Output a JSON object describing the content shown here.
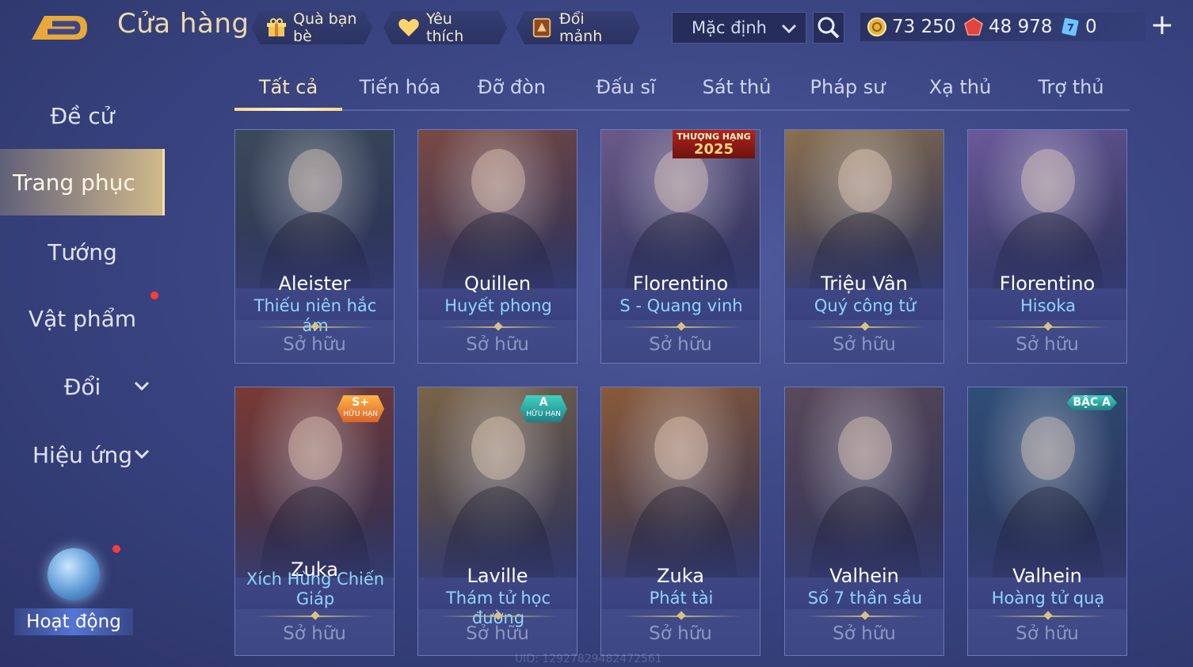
{
  "header": {
    "title": "Cửa hàng",
    "gift_label": "Quà bạn bè",
    "favorite_label": "Yêu thích",
    "shard_label": "Đổi mảnh",
    "sort_value": "Mặc định"
  },
  "currency": {
    "gold": "73 250",
    "ruby": "48 978",
    "voucher": "0"
  },
  "sidebar": {
    "items": [
      {
        "label": "Đề cử"
      },
      {
        "label": "Trang phục"
      },
      {
        "label": "Tướng"
      },
      {
        "label": "Vật phẩm"
      },
      {
        "label": "Đổi"
      },
      {
        "label": "Hiệu ứng"
      }
    ],
    "event_label": "Hoạt động"
  },
  "tabs": [
    "Tất cả",
    "Tiến hóa",
    "Đỡ đòn",
    "Đấu sĩ",
    "Sát thủ",
    "Pháp sư",
    "Xạ thủ",
    "Trợ thủ"
  ],
  "cards": [
    {
      "hero": "Aleister",
      "skin": "Thiếu niên hắc ám",
      "status": "Sở hữu",
      "art_color": "#3b4a5a"
    },
    {
      "hero": "Quillen",
      "skin": "Huyết phong",
      "status": "Sở hữu",
      "art_color": "#7a4a44"
    },
    {
      "hero": "Florentino",
      "skin": "S - Quang vinh",
      "status": "Sở hữu",
      "art_color": "#6a5a8a",
      "ribbon_top": "THƯỢNG HẠNG",
      "ribbon_year": "2025"
    },
    {
      "hero": "Triệu Vân",
      "skin": "Quý công tử",
      "status": "Sở hữu",
      "art_color": "#8a7050"
    },
    {
      "hero": "Florentino",
      "skin": "Hisoka",
      "status": "Sở hữu",
      "art_color": "#6a5a9a"
    },
    {
      "hero": "Zuka",
      "skin": "Xích Hùng Chiến Giáp",
      "status": "Sở hữu",
      "art_color": "#7a3a34",
      "badge": "S+",
      "badge_sub": "HỮU HẠN"
    },
    {
      "hero": "Laville",
      "skin": "Thám tử học đường",
      "status": "Sở hữu",
      "art_color": "#7a6448",
      "badge": "A",
      "badge_sub": "HỮU HẠN"
    },
    {
      "hero": "Zuka",
      "skin": "Phát tài",
      "status": "Sở hữu",
      "art_color": "#8a5a3a"
    },
    {
      "hero": "Valhein",
      "skin": "Số 7 thần sầu",
      "status": "Sở hữu",
      "art_color": "#5a4a5a"
    },
    {
      "hero": "Valhein",
      "skin": "Hoàng tử quạ",
      "status": "Sở hữu",
      "art_color": "#2f4f78",
      "badge": "BẬC A"
    }
  ],
  "uid": "UID: 1292782948247256​1"
}
